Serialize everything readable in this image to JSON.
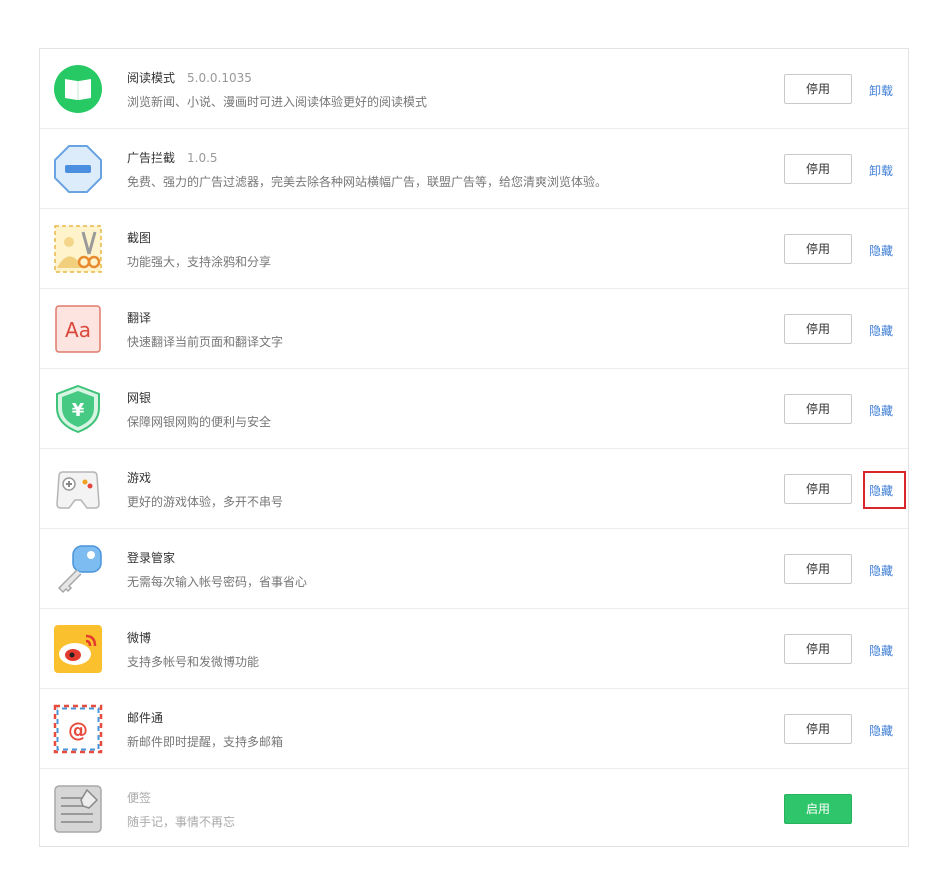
{
  "extensions": [
    {
      "name": "阅读模式",
      "version": "5.0.0.1035",
      "desc": "浏览新闻、小说、漫画时可进入阅读体验更好的阅读模式",
      "button": "停用",
      "link": "卸载",
      "icon": "book-icon"
    },
    {
      "name": "广告拦截",
      "version": "1.0.5",
      "desc": "免费、强力的广告过滤器，完美去除各种网站横幅广告，联盟广告等，给您清爽浏览体验。",
      "button": "停用",
      "link": "卸载",
      "icon": "ad-block-icon"
    },
    {
      "name": "截图",
      "version": "",
      "desc": "功能强大，支持涂鸦和分享",
      "button": "停用",
      "link": "隐藏",
      "icon": "screenshot-scissors-icon"
    },
    {
      "name": "翻译",
      "version": "",
      "desc": "快速翻译当前页面和翻译文字",
      "button": "停用",
      "link": "隐藏",
      "icon": "translate-icon"
    },
    {
      "name": "网银",
      "version": "",
      "desc": "保障网银网购的便利与安全",
      "button": "停用",
      "link": "隐藏",
      "icon": "shield-yen-icon"
    },
    {
      "name": "游戏",
      "version": "",
      "desc": "更好的游戏体验，多开不串号",
      "button": "停用",
      "link": "隐藏",
      "icon": "gamepad-icon"
    },
    {
      "name": "登录管家",
      "version": "",
      "desc": "无需每次输入帐号密码，省事省心",
      "button": "停用",
      "link": "隐藏",
      "icon": "key-icon"
    },
    {
      "name": "微博",
      "version": "",
      "desc": "支持多帐号和发微博功能",
      "button": "停用",
      "link": "隐藏",
      "icon": "weibo-icon"
    },
    {
      "name": "邮件通",
      "version": "",
      "desc": "新邮件即时提醒，支持多邮箱",
      "button": "停用",
      "link": "隐藏",
      "icon": "mail-icon"
    },
    {
      "name": "便签",
      "version": "",
      "desc": "随手记，事情不再忘",
      "button": "启用",
      "link": "",
      "icon": "notepad-icon"
    }
  ],
  "colors": {
    "accent_green": "#2fc56a",
    "link_blue": "#3d7dd6",
    "highlight_red": "#d8262c"
  }
}
